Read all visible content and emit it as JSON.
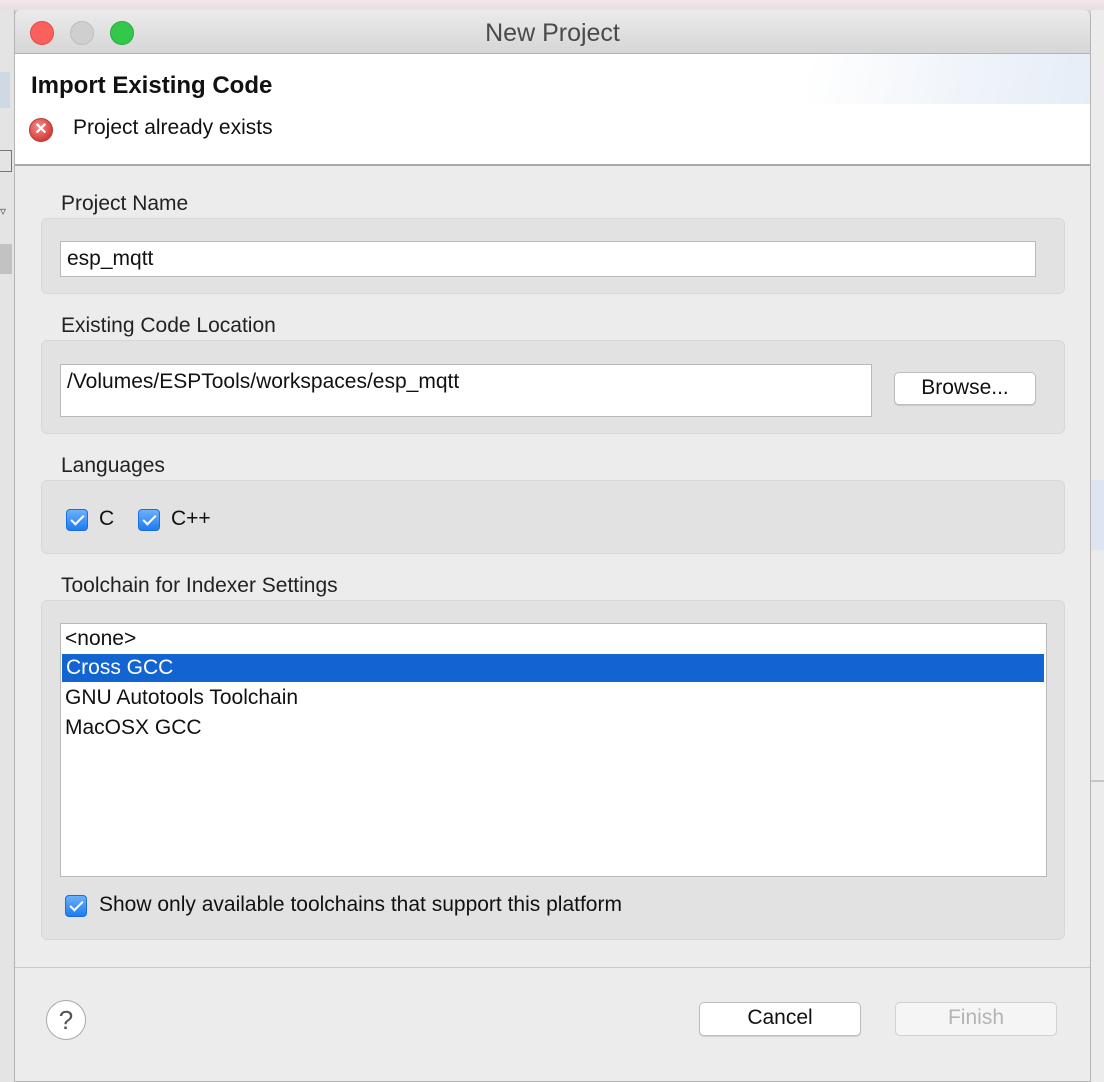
{
  "window": {
    "title": "New Project"
  },
  "banner": {
    "title": "Import Existing Code",
    "message": "Project already exists",
    "message_icon": "error-icon",
    "error_color": "#d4403a"
  },
  "project_name": {
    "label": "Project Name",
    "value": "esp_mqtt"
  },
  "code_location": {
    "label": "Existing Code Location",
    "value": "/Volumes/ESPTools/workspaces/esp_mqtt",
    "browse_label": "Browse..."
  },
  "languages": {
    "label": "Languages",
    "options": [
      {
        "label": "C",
        "checked": true
      },
      {
        "label": "C++",
        "checked": true
      }
    ]
  },
  "toolchain": {
    "label": "Toolchain for Indexer Settings",
    "items": [
      "<none>",
      "Cross GCC",
      "GNU Autotools Toolchain",
      "MacOSX GCC"
    ],
    "selected": "Cross GCC",
    "show_only_available_label": "Show only available toolchains that support this platform",
    "show_only_available_checked": true
  },
  "footer": {
    "help_glyph": "?",
    "cancel_label": "Cancel",
    "finish_label": "Finish",
    "finish_enabled": false
  },
  "colors": {
    "selection": "#1264d2",
    "checkbox_accent": "#1d7cf2"
  }
}
